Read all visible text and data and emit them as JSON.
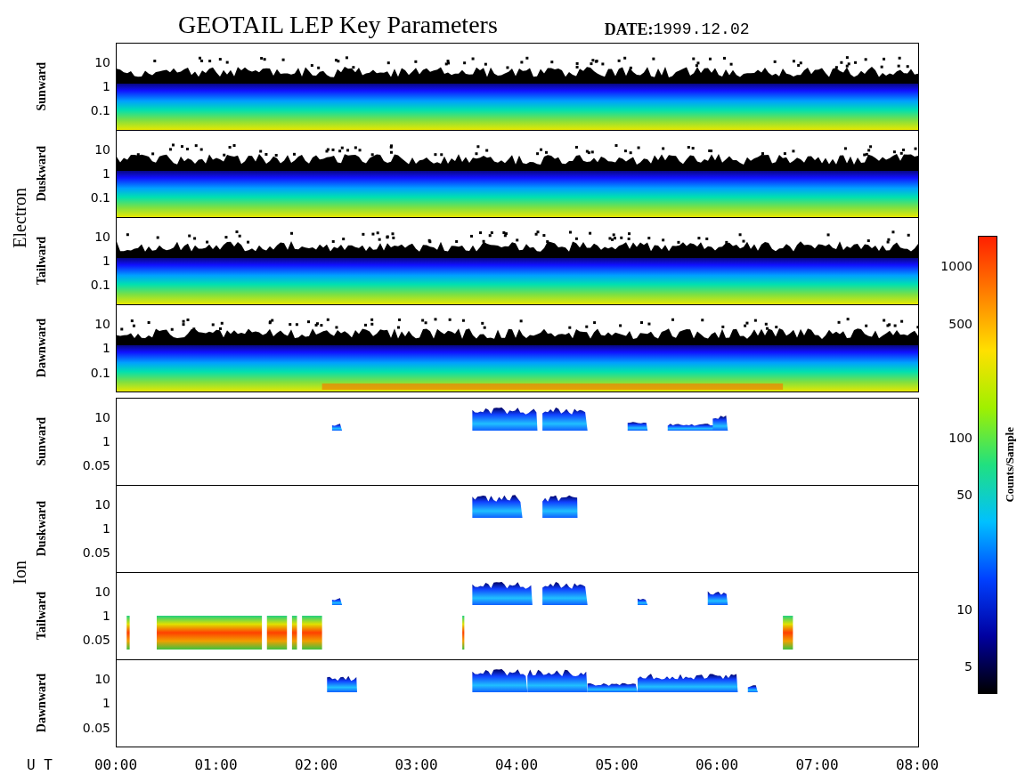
{
  "title": "GEOTAIL LEP Key Parameters",
  "date": {
    "label": "DATE:",
    "value": "1999.12.02"
  },
  "groups": [
    {
      "name": "Electron",
      "kind": "electron",
      "panels": [
        {
          "name": "Sunward",
          "yticks": [
            "10",
            "1",
            "0.1"
          ]
        },
        {
          "name": "Duskward",
          "yticks": [
            "10",
            "1",
            "0.1"
          ]
        },
        {
          "name": "Tailward",
          "yticks": [
            "10",
            "1",
            "0.1"
          ]
        },
        {
          "name": "Dawnward",
          "yticks": [
            "10",
            "1",
            "0.1"
          ]
        }
      ]
    },
    {
      "name": "Ion",
      "kind": "ion",
      "panels": [
        {
          "name": "Sunward",
          "yticks": [
            "10",
            "1",
            "0.05"
          ]
        },
        {
          "name": "Duskward",
          "yticks": [
            "10",
            "1",
            "0.05"
          ]
        },
        {
          "name": "Tailward",
          "yticks": [
            "10",
            "1",
            "0.05"
          ]
        },
        {
          "name": "Dawnward",
          "yticks": [
            "10",
            "1",
            "0.05"
          ]
        }
      ]
    }
  ],
  "x_axis": {
    "label": "U T",
    "ticks": [
      "00:00",
      "01:00",
      "02:00",
      "03:00",
      "04:00",
      "05:00",
      "06:00",
      "07:00",
      "08:00"
    ]
  },
  "colorbar": {
    "label": "Counts/Sample",
    "ticks": [
      "1000",
      "500",
      "100",
      "50",
      "10",
      "5"
    ]
  }
}
